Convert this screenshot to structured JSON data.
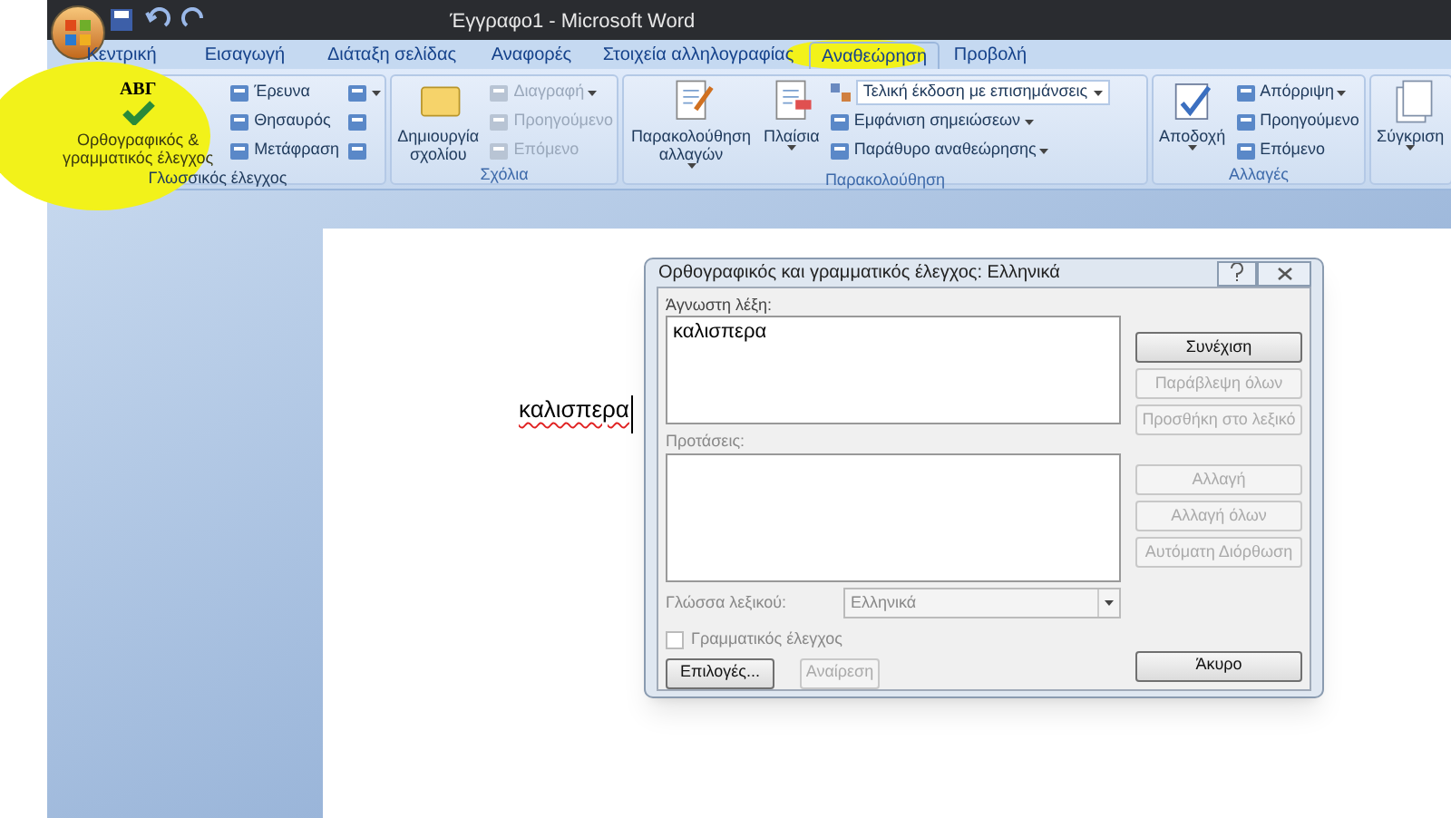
{
  "window": {
    "title": "Έγγραφο1 - Microsoft Word"
  },
  "tabs": [
    {
      "label": "Κεντρική",
      "selected": false
    },
    {
      "label": "Εισαγωγή",
      "selected": false
    },
    {
      "label": "Διάταξη σελίδας",
      "selected": false
    },
    {
      "label": "Αναφορές",
      "selected": false
    },
    {
      "label": "Στοιχεία αλληλογραφίας",
      "selected": false
    },
    {
      "label": "Αναθεώρηση",
      "selected": true
    },
    {
      "label": "Προβολή",
      "selected": false
    }
  ],
  "ribbon": {
    "groups": [
      {
        "label": "Γλωσσικός έλεγχος",
        "items": [
          {
            "kind": "large",
            "label": "Ορθογραφικός & γραμματικός έλεγχος",
            "icon_text": "ΑΒΓ",
            "disabled": false,
            "menu": false
          },
          {
            "kind": "small",
            "label": "Έρευνα",
            "disabled": false,
            "menu": false
          },
          {
            "kind": "small",
            "label": "Θησαυρός",
            "disabled": false,
            "menu": false
          },
          {
            "kind": "small",
            "label": "Μετάφραση",
            "disabled": false,
            "menu": false
          },
          {
            "kind": "icon",
            "disabled": false,
            "menu": true
          },
          {
            "kind": "icon",
            "disabled": false,
            "menu": false
          },
          {
            "kind": "icon",
            "disabled": false,
            "menu": false
          }
        ]
      },
      {
        "label": "Σχόλια",
        "items": [
          {
            "kind": "large",
            "label": "Δημιουργία σχολίου",
            "disabled": false,
            "menu": false
          },
          {
            "kind": "small",
            "label": "Διαγραφή",
            "disabled": true,
            "menu": true
          },
          {
            "kind": "small",
            "label": "Προηγούμενο",
            "disabled": true,
            "menu": false
          },
          {
            "kind": "small",
            "label": "Επόμενο",
            "disabled": true,
            "menu": false
          }
        ]
      },
      {
        "label": "Παρακολούθηση",
        "items": [
          {
            "kind": "large",
            "label": "Παρακολούθηση αλλαγών",
            "disabled": false,
            "menu": true
          },
          {
            "kind": "large",
            "label": "Πλαίσια",
            "disabled": false,
            "menu": true
          },
          {
            "kind": "dropdown",
            "label": "Τελική έκδοση με επισημάνσεις",
            "disabled": false,
            "menu": true
          },
          {
            "kind": "small",
            "label": "Εμφάνιση σημειώσεων",
            "disabled": false,
            "menu": true
          },
          {
            "kind": "small",
            "label": "Παράθυρο αναθεώρησης",
            "disabled": false,
            "menu": true
          }
        ]
      },
      {
        "label": "Αλλαγές",
        "items": [
          {
            "kind": "large",
            "label": "Αποδοχή",
            "disabled": false,
            "menu": true
          },
          {
            "kind": "small",
            "label": "Απόρριψη",
            "disabled": false,
            "menu": true
          },
          {
            "kind": "small",
            "label": "Προηγούμενο",
            "disabled": false,
            "menu": false
          },
          {
            "kind": "small",
            "label": "Επόμενο",
            "disabled": false,
            "menu": false
          }
        ]
      },
      {
        "items": [
          {
            "kind": "large",
            "label": "Σύγκριση",
            "disabled": false,
            "menu": true
          }
        ]
      }
    ]
  },
  "document": {
    "text": "καλισπερα",
    "misspelled": true
  },
  "dialog": {
    "title": "Ορθογραφικός και γραμματικός έλεγχος: Ελληνικά",
    "unknown_word_label": "Άγνωστη λέξη:",
    "unknown_word": "καλισπερα",
    "suggestions_label": "Προτάσεις:",
    "language_label": "Γλώσσα λεξικού:",
    "language": "Ελληνικά",
    "grammar_check": {
      "label": "Γραμματικός έλεγχος",
      "checked": false
    },
    "word_buttons": [
      {
        "label": "Συνέχιση",
        "disabled": false
      },
      {
        "label": "Παράβλεψη όλων",
        "disabled": true
      },
      {
        "label": "Προσθήκη στο λεξικό",
        "disabled": true
      }
    ],
    "suggestion_buttons": [
      {
        "label": "Αλλαγή",
        "disabled": true
      },
      {
        "label": "Αλλαγή όλων",
        "disabled": true
      },
      {
        "label": "Αυτόματη Διόρθωση",
        "disabled": true
      }
    ],
    "bottom_buttons": [
      {
        "label": "Επιλογές...",
        "disabled": false
      },
      {
        "label": "Αναίρεση",
        "disabled": true
      }
    ],
    "cancel_button": {
      "label": "Άκυρο",
      "disabled": false
    }
  }
}
